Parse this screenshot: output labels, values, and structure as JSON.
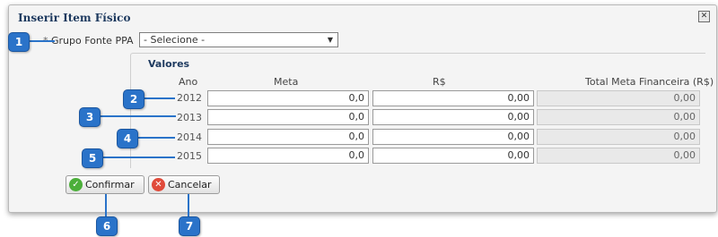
{
  "dialog": {
    "title": "Inserir Item Físico",
    "close_icon": "close-icon"
  },
  "form": {
    "required_marker": "*",
    "grupo_label": "Grupo Fonte PPA",
    "grupo_value": "- Selecione -"
  },
  "valores": {
    "title": "Valores",
    "columns": [
      "Ano",
      "Meta",
      "R$",
      "Total Meta Financeira (R$)"
    ],
    "rows": [
      {
        "ano": "2012",
        "meta": "0,0",
        "rs": "0,00",
        "total": "0,00"
      },
      {
        "ano": "2013",
        "meta": "0,0",
        "rs": "0,00",
        "total": "0,00"
      },
      {
        "ano": "2014",
        "meta": "0,0",
        "rs": "0,00",
        "total": "0,00"
      },
      {
        "ano": "2015",
        "meta": "0,0",
        "rs": "0,00",
        "total": "0,00"
      }
    ]
  },
  "buttons": {
    "confirm_label": "Confirmar",
    "cancel_label": "Cancelar"
  },
  "callouts": [
    "1",
    "2",
    "3",
    "4",
    "5",
    "6",
    "7"
  ],
  "colors": {
    "callout_blue": "#2a73c9",
    "confirm_green": "#4caf3a",
    "cancel_red": "#e04a3a"
  }
}
